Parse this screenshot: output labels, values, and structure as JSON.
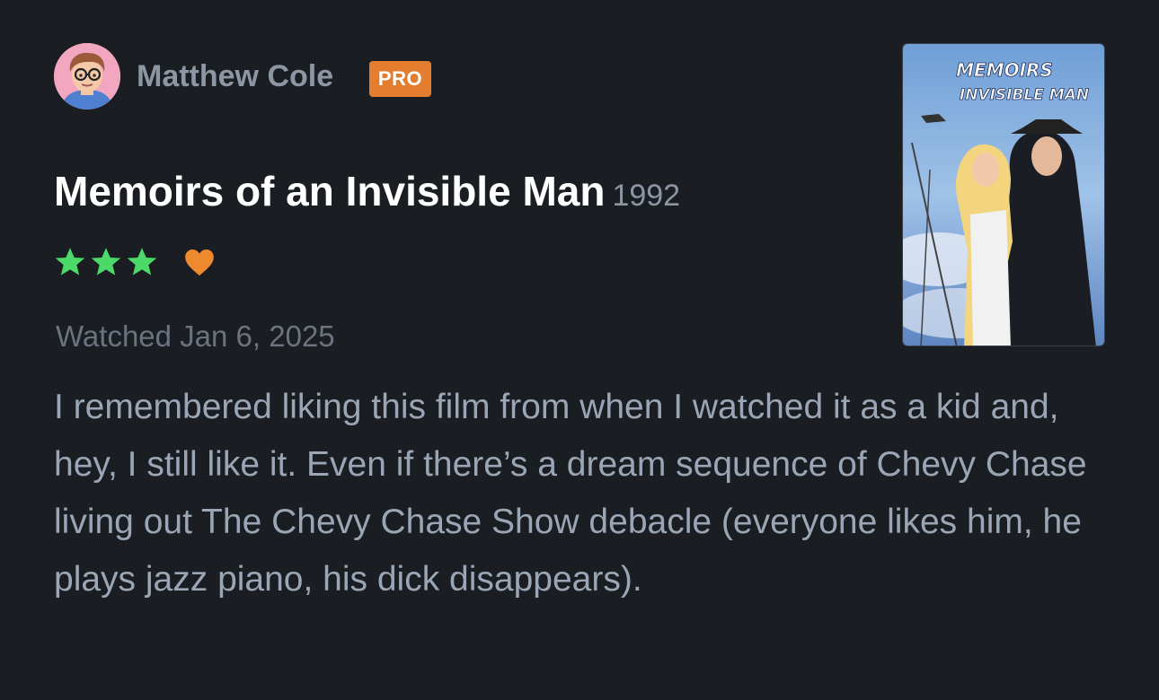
{
  "user": {
    "name": "Matthew Cole",
    "badge": "PRO",
    "avatar_icon": "memoji-avatar"
  },
  "film": {
    "title": "Memoirs of an Invisible Man",
    "year": "1992",
    "poster_alt": "Memoirs of an Invisible Man poster"
  },
  "rating": {
    "stars": 3,
    "max_stars": 5,
    "liked": true,
    "star_color": "#4cd96a",
    "heart_color": "#ee8a2e"
  },
  "watched_text": "Watched Jan 6, 2025",
  "review_text": "I remembered liking this film from when I watched it as a kid and, hey, I still like it. Even if there’s a dream sequence of Chevy Chase living out The Chevy Chase Show debacle (everyone likes him, he plays jazz piano, his dick disappears).",
  "colors": {
    "background": "#1a1d22",
    "pro_badge": "#e47d2e"
  }
}
